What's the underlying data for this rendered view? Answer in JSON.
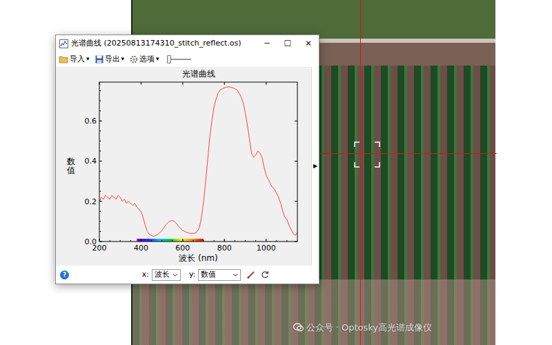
{
  "window": {
    "title": "光谱曲线 (20250813174310_stitch_reflect.os)",
    "controls": [
      "─",
      "☐",
      "✕"
    ]
  },
  "toolbar": {
    "items": [
      {
        "label": "导入",
        "caret": "▾"
      },
      {
        "label": "导出",
        "caret": "▾"
      },
      {
        "label": "选项",
        "caret": "▾"
      }
    ],
    "slider": {
      "level": 0.08
    }
  },
  "chart": {
    "title": "光谱曲线",
    "y_label": "数值",
    "x_label": "波长 (nm)",
    "x_ticks": [
      "200",
      "400",
      "600",
      "800",
      "1000"
    ],
    "y_ticks": [
      "0.0",
      "0.2",
      "0.4",
      "0.6"
    ],
    "series": [
      {
        "x": [
          200,
          210,
          220,
          230,
          240,
          250,
          260,
          270,
          280,
          290,
          300,
          310,
          320,
          330,
          340,
          350,
          360,
          370,
          380,
          390,
          400,
          410,
          420,
          430,
          440,
          450,
          460,
          470,
          480,
          490,
          500,
          510,
          520,
          530,
          540,
          550,
          560,
          570,
          580,
          590,
          600,
          610,
          620,
          630,
          640,
          650,
          660,
          670,
          680,
          690,
          700,
          710,
          720,
          730,
          740,
          750,
          760,
          770,
          780,
          790,
          800,
          810,
          820,
          830,
          840,
          850,
          860,
          870,
          880,
          890,
          900,
          910,
          920,
          930,
          940,
          950,
          960,
          970,
          980,
          990,
          1000,
          1010,
          1020,
          1030,
          1040,
          1050,
          1060,
          1070,
          1080,
          1090,
          1100,
          1110,
          1120,
          1130,
          1140,
          1150
        ],
        "y": [
          0.2,
          0.22,
          0.21,
          0.23,
          0.22,
          0.21,
          0.23,
          0.22,
          0.21,
          0.23,
          0.22,
          0.2,
          0.21,
          0.19,
          0.2,
          0.19,
          0.18,
          0.19,
          0.17,
          0.16,
          0.15,
          0.12,
          0.08,
          0.05,
          0.035,
          0.03,
          0.025,
          0.03,
          0.035,
          0.045,
          0.055,
          0.07,
          0.085,
          0.095,
          0.102,
          0.105,
          0.1,
          0.09,
          0.075,
          0.065,
          0.055,
          0.05,
          0.045,
          0.042,
          0.04,
          0.04,
          0.042,
          0.05,
          0.07,
          0.12,
          0.2,
          0.3,
          0.41,
          0.52,
          0.6,
          0.67,
          0.71,
          0.74,
          0.755,
          0.76,
          0.765,
          0.768,
          0.77,
          0.768,
          0.765,
          0.76,
          0.755,
          0.74,
          0.72,
          0.69,
          0.64,
          0.58,
          0.51,
          0.44,
          0.42,
          0.43,
          0.45,
          0.44,
          0.42,
          0.37,
          0.33,
          0.31,
          0.29,
          0.27,
          0.26,
          0.24,
          0.22,
          0.19,
          0.15,
          0.12,
          0.11,
          0.08,
          0.06,
          0.04,
          0.03,
          0.045
        ]
      }
    ]
  },
  "side_arrow": "▶",
  "footer": {
    "help": "?",
    "x_label": "x:",
    "x_value": "波长",
    "y_label": "y:",
    "y_value": "数值"
  },
  "watermark": "公众号 · Optosky高光谱成像仪"
}
